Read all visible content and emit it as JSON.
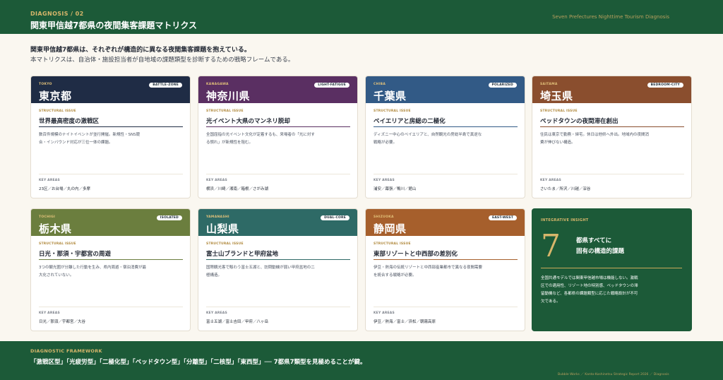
{
  "header": {
    "eyebrow": "DIAGNOSIS / 02",
    "title": "関東甲信越7都県の夜間集客課題マトリクス",
    "right_caption": "Seven Prefectures Nighttime Tourism Diagnosis"
  },
  "intro": {
    "line1": "関東甲信越7都県は、それぞれが構造的に異なる夜間集客課題を抱えている。",
    "line2": "本マトリクスは、自治体・施設担当者が自地域の課題類型を診断するための戦略フレームである。"
  },
  "labels": {
    "structural_issue": "STRUCTURAL ISSUE",
    "key_areas": "KEY AREAS"
  },
  "cards": [
    {
      "en": "TOKYO",
      "name": "東京都",
      "tag": "BATTLE-ZONE",
      "color": "#1f2c45",
      "issue": "世界最高密度の激戦区",
      "desc": "数百件規模のナイトイベントが並行開催。新規性・SNS競合・インバウンド対応が三位一体の課題。",
      "areas": "23区／お台場／丸の内／多摩"
    },
    {
      "en": "KANAGAWA",
      "name": "神奈川県",
      "tag": "LIGHT-FATIGUE",
      "color": "#5a2f62",
      "issue": "光イベント大県のマンネリ脱却",
      "desc": "全国屈指の光イベント文化が定着するも、来場者の「光に対する慣れ」が新規性を阻む。",
      "areas": "横浜／川崎／湘南／箱根／さがみ湖"
    },
    {
      "en": "CHIBA",
      "name": "千葉県",
      "tag": "POLARIZED",
      "color": "#325a86",
      "issue": "ベイエリアと房総の二極化",
      "desc": "ディズニー中心のベイエリアと、自然観光の房総半島で真逆な戦略が必要。",
      "areas": "浦安／幕張／鴨川／館山"
    },
    {
      "en": "SAITAMA",
      "name": "埼玉県",
      "tag": "BEDROOM-CITY",
      "color": "#8a4e2e",
      "issue": "ベッドタウンの夜間滞在創出",
      "desc": "住民は東京で勤務・帰宅。休日は他県へ外出。地域内の夜間消費が伸びない構造。",
      "areas": "さいたま／所沢／川越／深谷"
    },
    {
      "en": "TOCHIGI",
      "name": "栃木県",
      "tag": "ISOLATED",
      "color": "#6b7e3e",
      "issue": "日光・那須・宇都宮の周遊",
      "desc": "3つの観光圏が分離した行動を生み、県内周遊・宿泊消費が最大化されていない。",
      "areas": "日光／那須／宇都宮／大谷"
    },
    {
      "en": "YAMANASHI",
      "name": "山梨県",
      "tag": "DUAL-CORE",
      "color": "#2e6a66",
      "issue": "富士山ブランドと甲府盆地",
      "desc": "国際観光客で賑わう富士五湖と、訪問動機が弱い甲府盆地の二極構造。",
      "areas": "富士五湖／富士吉田／甲府／八ヶ岳"
    },
    {
      "en": "SHIZUOKA",
      "name": "静岡県",
      "tag": "EAST-WEST",
      "color": "#a65f2c",
      "issue": "東部リゾートと中西部の差別化",
      "desc": "伊豆・熱海の伝統リゾートと中西部産業都市で異なる夜間需要を統合する戦略が必要。",
      "areas": "伊豆／熱海／富士／浜松／朝霧高原"
    }
  ],
  "insight": {
    "label": "INTEGRATIVE INSIGHT",
    "number": "7",
    "headline_1": "都県すべてに",
    "headline_2": "固有の構造的課題",
    "body": "全国共通モデルでは関東甲信越市場は機能しない。激戦区での適用性、リゾート地の特別感、ベッドタウンの滞留動機など、各都県の課題類型に応じた戦略設計が不可欠である。"
  },
  "footer": {
    "label": "DIAGNOSTIC FRAMEWORK",
    "text": "「激戦区型」「光疲労型」「二極化型」「ベッドタウン型」「分離型」「二核型」「東西型」── 7都県7類型を見極めることが鍵。",
    "credit": "Bubble Works ／ Kanto-Koshinetsu Strategic Report 2026 ／ Diagnosis"
  }
}
